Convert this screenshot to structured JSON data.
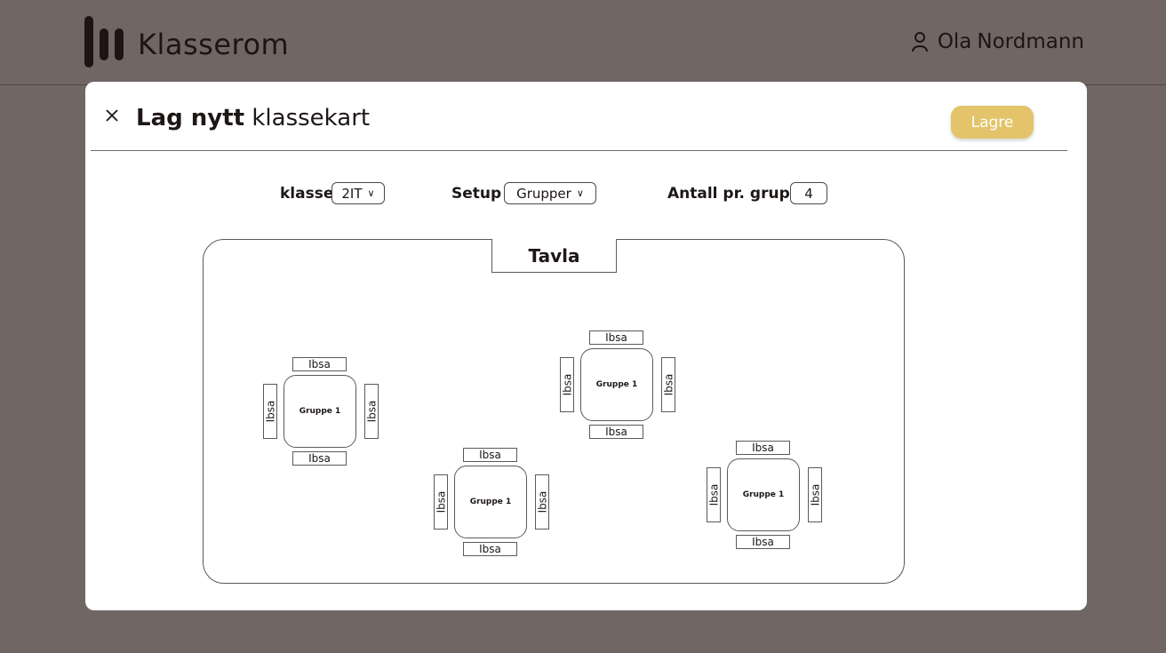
{
  "app": {
    "brand": "Klasserom",
    "user_first": "Ola",
    "user_last": "Nordmann"
  },
  "modal": {
    "title_bold": "Lag nytt",
    "title_rest": "klassekart",
    "save_label": "Lagre"
  },
  "controls": {
    "klasse_label": "klasse",
    "klasse_value": "2IT",
    "setup_label": "Setup",
    "setup_value": "Grupper",
    "antall_label": "Antall pr. gruppe",
    "antall_value": "4"
  },
  "room": {
    "board_label": "Tavla",
    "groups": [
      {
        "name": "Gruppe 1",
        "seats": [
          "Ibsa",
          "Ibsa",
          "Ibsa",
          "Ibsa"
        ]
      },
      {
        "name": "Gruppe 1",
        "seats": [
          "Ibsa",
          "Ibsa",
          "Ibsa",
          "Ibsa"
        ]
      },
      {
        "name": "Gruppe 1",
        "seats": [
          "Ibsa",
          "Ibsa",
          "Ibsa",
          "Ibsa"
        ]
      },
      {
        "name": "Gruppe 1",
        "seats": [
          "Ibsa",
          "Ibsa",
          "Ibsa",
          "Ibsa"
        ]
      }
    ]
  },
  "colors": {
    "background": "#706765",
    "accent": "#e3c46b",
    "text": "#1d1716"
  },
  "icons": {
    "user": "user-icon",
    "close": "close-icon",
    "chevron": "chevron-down-icon"
  }
}
